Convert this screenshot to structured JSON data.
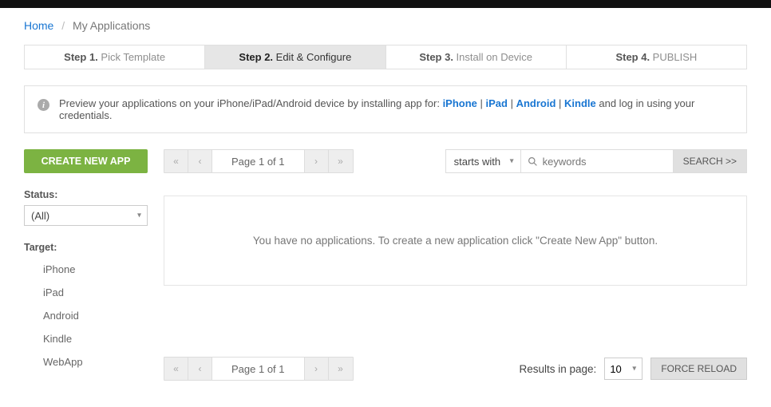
{
  "breadcrumb": {
    "home": "Home",
    "current": "My Applications"
  },
  "steps": [
    {
      "bold": "Step 1.",
      "rest": " Pick Template"
    },
    {
      "bold": "Step 2.",
      "rest": " Edit & Configure"
    },
    {
      "bold": "Step 3.",
      "rest": " Install on Device"
    },
    {
      "bold": "Step 4.",
      "rest": " PUBLISH"
    }
  ],
  "info": {
    "prefix": "Preview your applications on your iPhone/iPad/Android device by installing app for: ",
    "links": {
      "iphone": "iPhone",
      "ipad": "iPad",
      "android": "Android",
      "kindle": "Kindle"
    },
    "sep": " | ",
    "suffix": " and log in using your credentials."
  },
  "sidebar": {
    "create": "CREATE NEW APP",
    "status_label": "Status:",
    "status_value": "(All)",
    "target_label": "Target:",
    "targets": [
      "iPhone",
      "iPad",
      "Android",
      "Kindle",
      "WebApp"
    ]
  },
  "pager": {
    "label": "Page 1 of 1"
  },
  "search": {
    "mode": "starts with",
    "placeholder": "keywords",
    "button": "SEARCH >>"
  },
  "empty": "You have no applications. To create a new application click \"Create New App\" button.",
  "bottom": {
    "results_label": "Results in page:",
    "perpage": "10",
    "force": "FORCE RELOAD"
  }
}
